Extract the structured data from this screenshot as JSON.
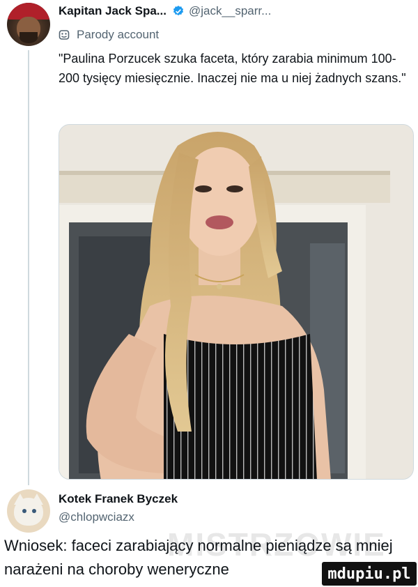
{
  "post": {
    "author_display_name": "Kapitan Jack Spa...",
    "author_handle": "@jack__sparr...",
    "account_label": "Parody account",
    "text": "\"Paulina Porzucek szuka faceta, który zarabia minimum 100-200 tysięcy miesięcznie. Inaczej nie ma u niej żadnych szans.\""
  },
  "reply": {
    "author_display_name": "Kotek Franek Byczek",
    "author_handle": "@chlopwciazx",
    "text": "Wniosek: faceci zarabiający normalne pieniądze są mniej narażeni na choroby weneryczne"
  },
  "watermark": {
    "text": "MISTRZOWIE"
  },
  "site_badge": {
    "text": "mdupiu.pl"
  },
  "colors": {
    "verified": "#1d9bf0",
    "muted_text": "#536471",
    "thread_line": "#cfd9de",
    "badge_bg": "#111111"
  },
  "icons": {
    "verified": "verified-badge-icon",
    "parody": "parody-mask-icon"
  }
}
